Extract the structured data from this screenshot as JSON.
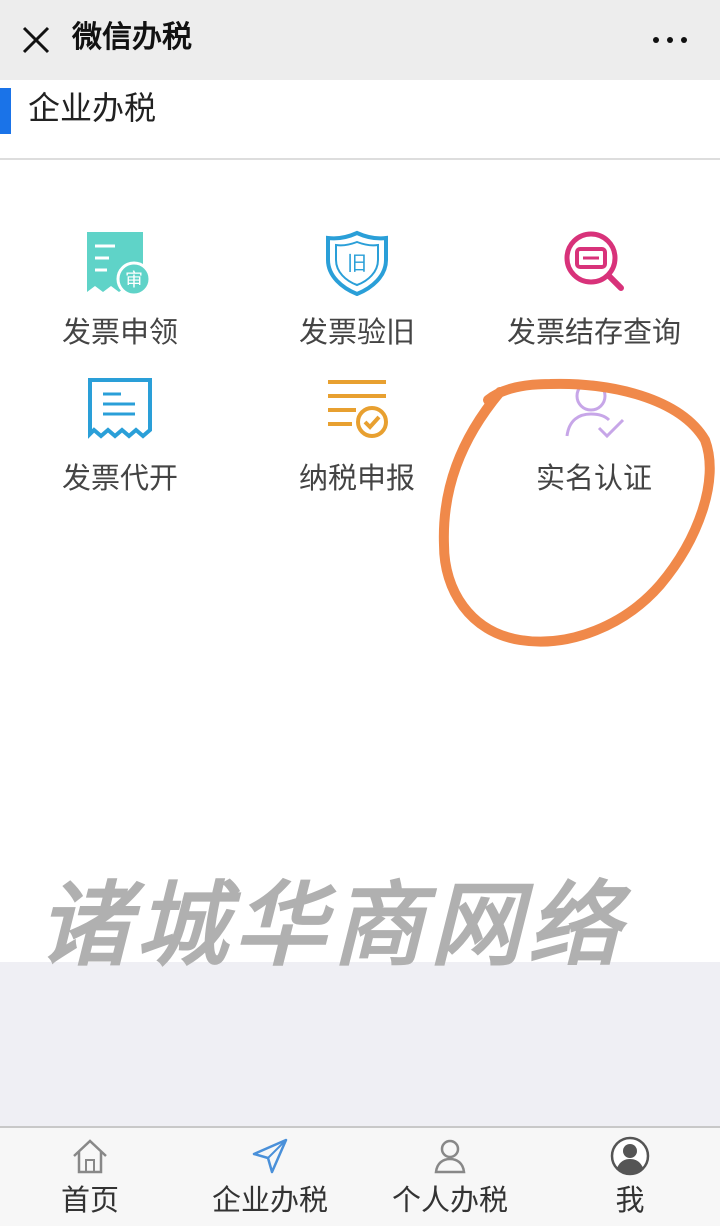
{
  "topbar": {
    "title": "微信办税",
    "close_icon": "close-icon",
    "more_icon": "more-icon"
  },
  "section": {
    "title": "企业办税",
    "accent_color": "#1a73e8"
  },
  "grid": [
    {
      "label": "发票申领",
      "icon": "invoice-apply-icon",
      "badge": "审",
      "color": "#5fd3c8"
    },
    {
      "label": "发票验旧",
      "icon": "invoice-verify-icon",
      "badge": "旧",
      "color": "#2a9fd8"
    },
    {
      "label": "发票结存查询",
      "icon": "invoice-inventory-search-icon",
      "color": "#d8327a"
    },
    {
      "label": "发票代开",
      "icon": "invoice-issue-icon",
      "color": "#2a9fd8"
    },
    {
      "label": "纳税申报",
      "icon": "tax-declaration-icon",
      "color": "#e8a030"
    },
    {
      "label": "实名认证",
      "icon": "user-verify-icon",
      "color": "#c7a6e8"
    }
  ],
  "watermark": "诸城华商网络",
  "annotation_color": "#f0894a",
  "tabs": [
    {
      "label": "首页",
      "icon": "home-icon"
    },
    {
      "label": "企业办税",
      "icon": "send-icon",
      "active_color": "#4a90d9"
    },
    {
      "label": "个人办税",
      "icon": "person-icon"
    },
    {
      "label": "我",
      "icon": "avatar-icon"
    }
  ]
}
